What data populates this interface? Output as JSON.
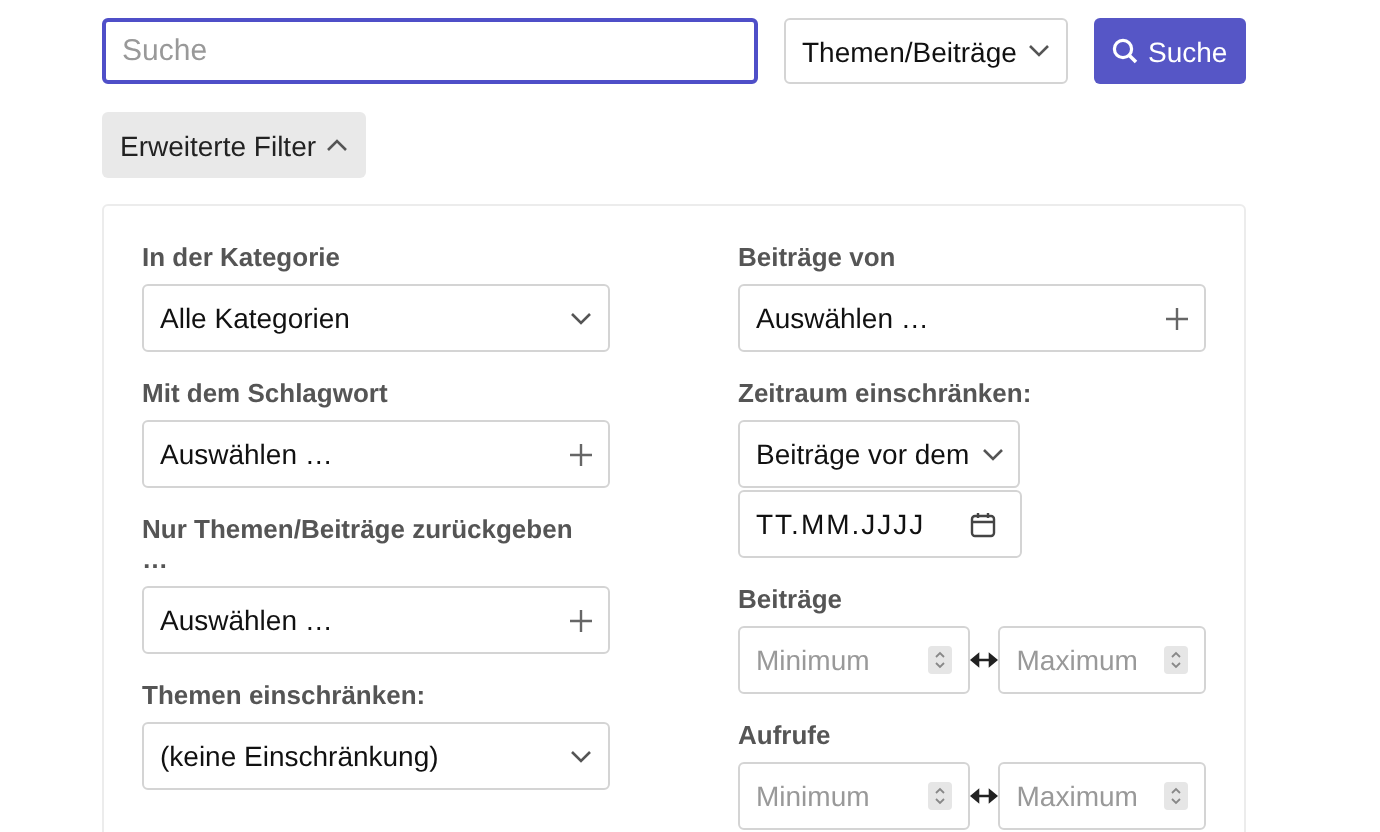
{
  "search": {
    "placeholder": "Suche",
    "focused": true
  },
  "scope_select": {
    "value": "Themen/Beiträge"
  },
  "search_button": {
    "label": "Suche"
  },
  "filter_toggle": {
    "label": "Erweiterte Filter",
    "expanded": true
  },
  "filters": {
    "left": [
      {
        "label": "In der Kategorie",
        "kind": "select",
        "value": "Alle Kategorien"
      },
      {
        "label": "Mit dem Schlagwort",
        "kind": "multi",
        "value": "Auswählen …"
      },
      {
        "label": "Nur Themen/Beiträge zurückgeben …",
        "kind": "multi",
        "value": "Auswählen …"
      },
      {
        "label": "Themen einschränken:",
        "kind": "select",
        "value": "(keine Einschränkung)"
      }
    ],
    "right": [
      {
        "label": "Beiträge von",
        "kind": "multi",
        "value": "Auswählen …"
      },
      {
        "label": "Zeitraum einschränken:",
        "kind": "date",
        "value": "Beiträge vor dem",
        "date": "TT.MM.JJJJ"
      },
      {
        "label": "Beiträge",
        "kind": "range",
        "min_placeholder": "Minimum",
        "max_placeholder": "Maximum"
      },
      {
        "label": "Aufrufe",
        "kind": "range",
        "min_placeholder": "Minimum",
        "max_placeholder": "Maximum"
      }
    ]
  }
}
